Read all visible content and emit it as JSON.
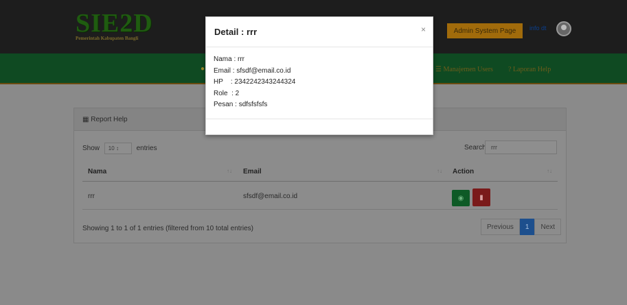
{
  "header": {
    "logo_text": "SIE2D",
    "logo_subtitle": "Pemerintah Kabupaten Bangli",
    "admin_button": "Admin System Page",
    "user_link": "info dt"
  },
  "nav": {
    "users": "☰ Manajemen Users",
    "help": "? Laporan Help"
  },
  "panel": {
    "title": "▦ Report Help",
    "show_label": "Show",
    "show_value": "10",
    "entries_label": "entries",
    "search_label": "Search:",
    "search_value": "rrr",
    "columns": [
      "Nama",
      "Email",
      "Action"
    ],
    "rows": [
      {
        "nama": "rrr",
        "email": "sfsdf@email.co.id"
      }
    ],
    "info": "Showing 1 to 1 of 1 entries (filtered from 10 total entries)",
    "pagination": {
      "previous": "Previous",
      "current": "1",
      "next": "Next"
    }
  },
  "modal": {
    "title": "Detail : rrr",
    "close": "×",
    "lines": [
      "Nama : rrr",
      "Email : sfsdf@email.co.id",
      "HP    : 2342242343244324",
      "Role  : 2",
      "Pesan : sdfsfsfsfs"
    ]
  }
}
